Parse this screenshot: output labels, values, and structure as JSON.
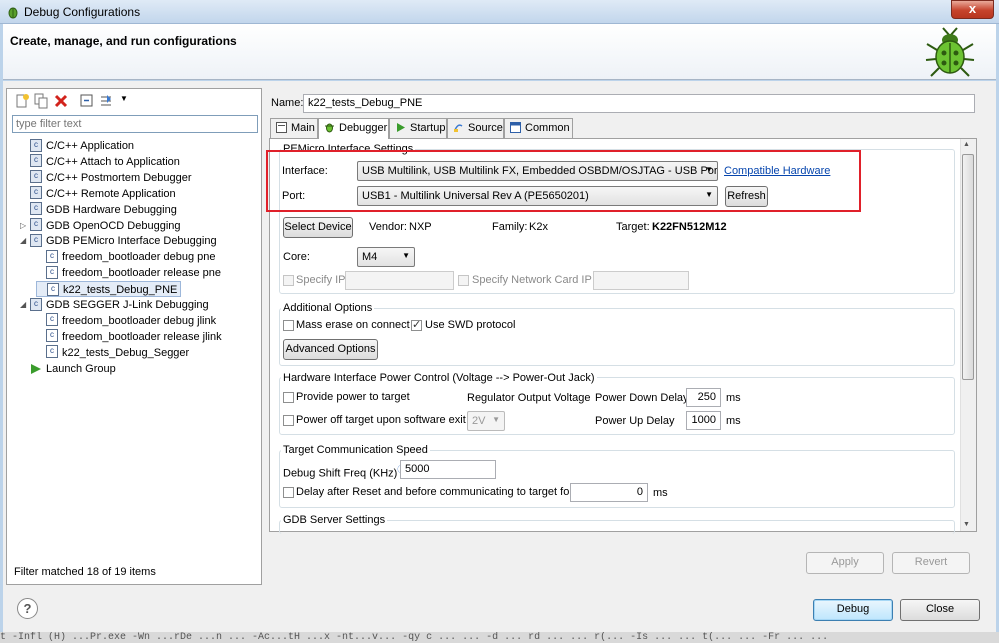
{
  "window": {
    "title": "Debug Configurations",
    "close_label": "x"
  },
  "header": {
    "title": "Create, manage, and run configurations"
  },
  "left_panel": {
    "filter_placeholder": "type filter text",
    "tree": [
      {
        "label": "C/C++ Application",
        "level": 1,
        "expander": "",
        "icon": "c-app-icon"
      },
      {
        "label": "C/C++ Attach to Application",
        "level": 1,
        "expander": "",
        "icon": "c-app-icon"
      },
      {
        "label": "C/C++ Postmortem Debugger",
        "level": 1,
        "expander": "",
        "icon": "c-app-icon"
      },
      {
        "label": "C/C++ Remote Application",
        "level": 1,
        "expander": "",
        "icon": "c-app-icon"
      },
      {
        "label": "GDB Hardware Debugging",
        "level": 1,
        "expander": "",
        "icon": "c-app-icon"
      },
      {
        "label": "GDB OpenOCD Debugging",
        "level": 1,
        "expander": "▷",
        "icon": "c-app-icon"
      },
      {
        "label": "GDB PEMicro Interface Debugging",
        "level": 1,
        "expander": "◢",
        "icon": "c-app-icon"
      },
      {
        "label": "freedom_bootloader debug pne",
        "level": 2,
        "expander": "",
        "icon": "c-app-icon"
      },
      {
        "label": "freedom_bootloader release pne",
        "level": 2,
        "expander": "",
        "icon": "c-app-icon"
      },
      {
        "label": "k22_tests_Debug_PNE",
        "level": 2,
        "expander": "",
        "icon": "c-app-icon",
        "selected": true
      },
      {
        "label": "GDB SEGGER J-Link Debugging",
        "level": 1,
        "expander": "◢",
        "icon": "c-app-icon"
      },
      {
        "label": "freedom_bootloader debug jlink",
        "level": 2,
        "expander": "",
        "icon": "c-app-icon"
      },
      {
        "label": "freedom_bootloader release jlink",
        "level": 2,
        "expander": "",
        "icon": "c-app-icon"
      },
      {
        "label": "k22_tests_Debug_Segger",
        "level": 2,
        "expander": "",
        "icon": "c-app-icon"
      },
      {
        "label": "Launch Group",
        "level": 1,
        "expander": "",
        "icon": "launch-group-icon"
      }
    ],
    "filter_status": "Filter matched 18 of 19 items"
  },
  "config": {
    "name_label": "Name:",
    "name_value": "k22_tests_Debug_PNE",
    "tabs": [
      {
        "label": "Main",
        "icon": "main-tab-icon"
      },
      {
        "label": "Debugger",
        "icon": "debugger-tab-icon",
        "active": true
      },
      {
        "label": "Startup",
        "icon": "startup-tab-icon"
      },
      {
        "label": "Source",
        "icon": "source-tab-icon"
      },
      {
        "label": "Common",
        "icon": "common-tab-icon"
      }
    ]
  },
  "pemicro": {
    "group_title": "PEMicro Interface Settings",
    "interface_label": "Interface:",
    "interface_value": "USB Multilink, USB Multilink FX, Embedded OSBDM/OSJTAG - USB Port",
    "compatible_hardware_link": "Compatible Hardware",
    "port_label": "Port:",
    "port_value": "USB1 - Multilink Universal Rev A (PE5650201)",
    "refresh_label": "Refresh",
    "select_device_label": "Select Device",
    "vendor_label": "Vendor:",
    "vendor_value": "NXP",
    "family_label": "Family:",
    "family_value": "K2x",
    "target_label": "Target:",
    "target_value": "K22FN512M12",
    "core_label": "Core:",
    "core_value": "M4",
    "specify_ip_label": "Specify IP",
    "specify_nic_label": "Specify Network Card IP"
  },
  "additional": {
    "group_title": "Additional Options",
    "mass_erase_label": "Mass erase on connect",
    "mass_erase_checked": false,
    "swd_label": "Use SWD protocol",
    "swd_checked": true,
    "advanced_label": "Advanced Options"
  },
  "power": {
    "group_title": "Hardware Interface Power Control (Voltage --> Power-Out Jack)",
    "provide_power_label": "Provide power to target",
    "regulator_label": "Regulator Output Voltage",
    "power_down_label": "Power Down Delay",
    "power_down_value": "250",
    "power_down_unit": "ms",
    "power_off_label": "Power off target upon software exit",
    "voltage_value": "2V",
    "power_up_label": "Power Up Delay",
    "power_up_value": "1000",
    "power_up_unit": "ms"
  },
  "comm": {
    "group_title": "Target Communication Speed",
    "shift_freq_label": "Debug Shift Freq (KHz)",
    "shift_freq_value": "5000",
    "delay_label": "Delay after Reset and before communicating to target for",
    "delay_value": "0",
    "delay_unit": "ms"
  },
  "gdb_server": {
    "group_title": "GDB Server Settings"
  },
  "buttons": {
    "apply": "Apply",
    "revert": "Revert",
    "debug": "Debug",
    "close": "Close",
    "help": "?"
  },
  "console_strip": "t  -Infl (H) ...Pr.exe -Wn ...rDe ...n ... -Ac...tH ...x -nt...v... -qy c ...  ... -d ... rd ... ... r(... -Is ... ... t(...  ... -Fr ... ..."
}
